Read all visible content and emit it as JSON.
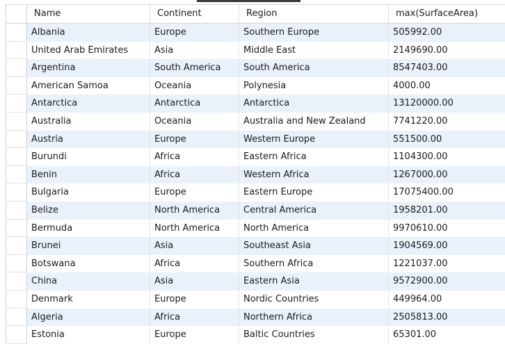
{
  "grid": {
    "columns": [
      "Name",
      "Continent",
      "Region",
      "max(SurfaceArea)"
    ],
    "rows": [
      [
        "Albania",
        "Europe",
        "Southern Europe",
        "505992.00"
      ],
      [
        "United Arab Emirates",
        "Asia",
        "Middle East",
        "2149690.00"
      ],
      [
        "Argentina",
        "South America",
        "South America",
        "8547403.00"
      ],
      [
        "American Samoa",
        "Oceania",
        "Polynesia",
        "4000.00"
      ],
      [
        "Antarctica",
        "Antarctica",
        "Antarctica",
        "13120000.00"
      ],
      [
        "Australia",
        "Oceania",
        "Australia and New Zealand",
        "7741220.00"
      ],
      [
        "Austria",
        "Europe",
        "Western Europe",
        "551500.00"
      ],
      [
        "Burundi",
        "Africa",
        "Eastern Africa",
        "1104300.00"
      ],
      [
        "Benin",
        "Africa",
        "Western Africa",
        "1267000.00"
      ],
      [
        "Bulgaria",
        "Europe",
        "Eastern Europe",
        "17075400.00"
      ],
      [
        "Belize",
        "North America",
        "Central America",
        "1958201.00"
      ],
      [
        "Bermuda",
        "North America",
        "North America",
        "9970610.00"
      ],
      [
        "Brunei",
        "Asia",
        "Southeast Asia",
        "1904569.00"
      ],
      [
        "Botswana",
        "Africa",
        "Southern Africa",
        "1221037.00"
      ],
      [
        "China",
        "Asia",
        "Eastern Asia",
        "9572900.00"
      ],
      [
        "Denmark",
        "Europe",
        "Nordic Countries",
        "449964.00"
      ],
      [
        "Algeria",
        "Africa",
        "Northern Africa",
        "2505813.00"
      ],
      [
        "Estonia",
        "Europe",
        "Baltic Countries",
        "65301.00"
      ]
    ],
    "colors": {
      "alt_row": "#e9f1fb",
      "row": "#ffffff",
      "gridline": "#e4e4e4"
    }
  }
}
